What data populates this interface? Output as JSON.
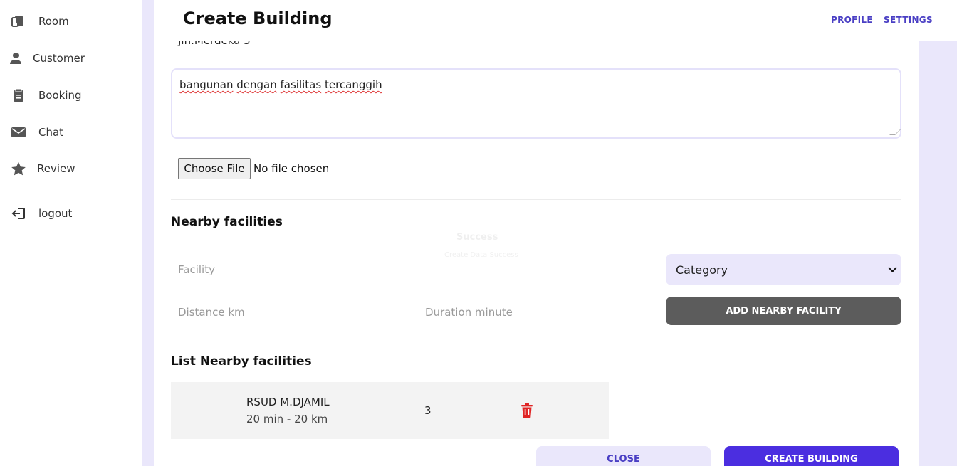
{
  "sidebar": {
    "items": [
      {
        "label": "Room",
        "icon": "room-icon"
      },
      {
        "label": "Customer",
        "icon": "user-icon"
      },
      {
        "label": "Booking",
        "icon": "clipboard-icon"
      },
      {
        "label": "Chat",
        "icon": "envelope-icon"
      },
      {
        "label": "Review",
        "icon": "star-icon"
      }
    ],
    "logout": {
      "label": "logout",
      "icon": "logout-icon"
    }
  },
  "header": {
    "title": "Create Building",
    "links": {
      "profile": "PROFILE",
      "settings": "SETTINGS"
    }
  },
  "form": {
    "address_value": "Jln.Merdeka 5",
    "description": {
      "w1": "bangunan",
      "w2": "dengan",
      "w3": "fasilitas",
      "w4": "tercanggih"
    },
    "file": {
      "button_label": "Choose File",
      "status": "No file chosen"
    }
  },
  "nearby": {
    "title": "Nearby facilities",
    "facility_placeholder": "Facility",
    "distance_placeholder": "Distance km",
    "duration_placeholder": "Duration minute",
    "category_selected": "Category",
    "add_button": "ADD NEARBY FACILITY"
  },
  "list": {
    "title": "List Nearby facilities",
    "items": [
      {
        "name": "RSUD M.DJAMIL",
        "meta": "20 min - 20 km",
        "category": "3"
      }
    ]
  },
  "footer": {
    "close": "CLOSE",
    "create": "CREATE BUILDING"
  },
  "ghost_toast": {
    "title": "Success",
    "message": "Create Data Success"
  },
  "colors": {
    "accent": "#4b2ee0",
    "accent_text": "#4a3fc4",
    "soft": "#eae7fb",
    "danger": "#e02424",
    "dark_button": "#5c5c5c"
  }
}
